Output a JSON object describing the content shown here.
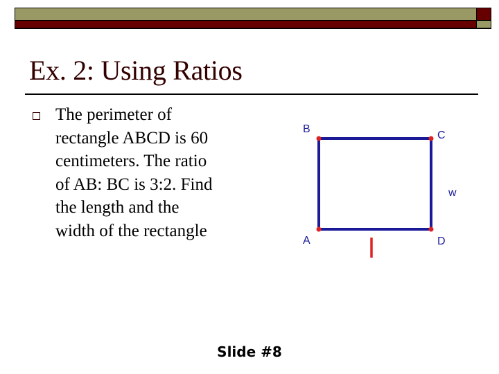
{
  "slide": {
    "title": "Ex. 2:  Using Ratios",
    "bullet_lines": [
      "The perimeter of",
      "rectangle ABCD is 60",
      "centimeters.  The ratio",
      "of AB: BC is 3:2.  Find",
      "the length and the",
      "width of the rectangle"
    ],
    "figure": {
      "vertices": {
        "A": "A",
        "B": "B",
        "C": "C",
        "D": "D"
      },
      "side_labels": {
        "width": "w",
        "length": "l"
      },
      "colors": {
        "edges": "#1a1a99",
        "points": "#dd2222",
        "length_label": "#dd2222"
      }
    },
    "footer": "Slide #8"
  },
  "theme": {
    "accent_olive": "#999966",
    "accent_darkred": "#660000",
    "title_color": "#330000"
  }
}
